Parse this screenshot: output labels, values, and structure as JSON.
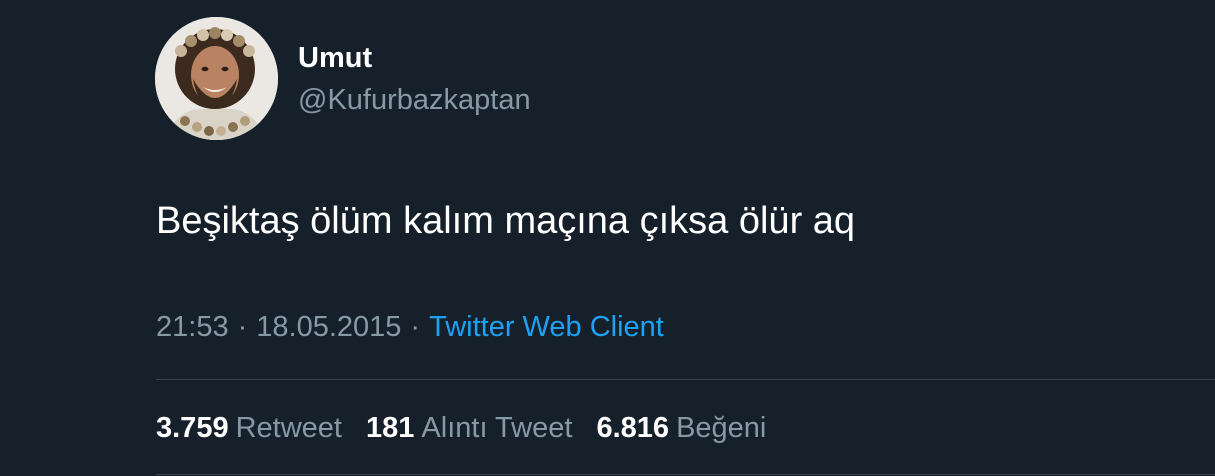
{
  "user": {
    "display_name": "Umut",
    "handle": "@Kufurbazkaptan"
  },
  "tweet": {
    "text": "Beşiktaş ölüm kalım maçına çıksa ölür aq",
    "time": "21:53",
    "separator": "·",
    "date": "18.05.2015",
    "client": "Twitter Web Client"
  },
  "stats": {
    "retweets": {
      "count": "3.759",
      "label": "Retweet"
    },
    "quotes": {
      "count": "181",
      "label": "Alıntı Tweet"
    },
    "likes": {
      "count": "6.816",
      "label": "Beğeni"
    }
  },
  "colors": {
    "background": "#15202b",
    "secondary_text": "#8899a6",
    "link": "#1da1f2",
    "divider": "#38444d"
  }
}
